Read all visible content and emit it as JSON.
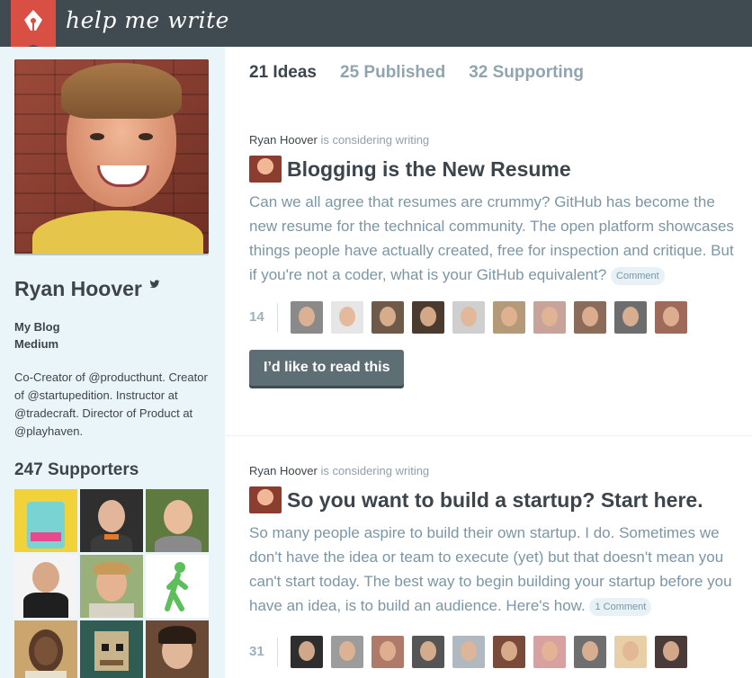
{
  "header": {
    "brand": "help me write"
  },
  "profile": {
    "name": "Ryan Hoover",
    "links": [
      "My Blog",
      "Medium"
    ],
    "bio": "Co-Creator of @producthunt. Creator of @startupedition. Instructor at @tradecraft. Director of Product at @playhaven.",
    "supporters_title": "247 Supporters"
  },
  "tabs": [
    {
      "label": "21 Ideas"
    },
    {
      "label": "25 Published"
    },
    {
      "label": "32 Supporting"
    }
  ],
  "posts": [
    {
      "author": "Ryan Hoover",
      "byline_suffix": "is considering writing",
      "title": "Blogging is the New Resume",
      "body": "Can we all agree that resumes are crummy? GitHub has become the new resume for the technical community. The open platform showcases things people have actually created, free for inspection and critique. But if you're not a coder, what is your GitHub equivalent?",
      "comment_label": "Comment",
      "supporter_count": "14",
      "button_label": "I’d like to read this"
    },
    {
      "author": "Ryan Hoover",
      "byline_suffix": "is considering writing",
      "title": "So you want to build a startup? Start here.",
      "body": "So many people aspire to build their own startup. I do. Sometimes we don't have the idea or team to execute (yet) but that doesn't mean you can't start today. The best way to begin building your startup before you have an idea, is to build an audience. Here's how.",
      "comment_label": "1 Comment",
      "supporter_count": "31"
    }
  ],
  "supporter_tile_colors": [
    "#f2d23a",
    "#3a3a3a",
    "#5f7a3f",
    "#f4f4f4",
    "#9ab07a",
    "#ffffff",
    "#caa66e",
    "#2f5d54",
    "#6b4a35"
  ],
  "post1_avatar_colors": [
    "#8a8a8a",
    "#e6e6e6",
    "#6f5a4a",
    "#4b3b2e",
    "#cfcfcf",
    "#b59a7a",
    "#c7a39a",
    "#8b6b5a",
    "#6d6d6d",
    "#a06a5a"
  ],
  "post2_avatar_colors": [
    "#2e2e2e",
    "#9c9c9c",
    "#b07a6a",
    "#555555",
    "#b0b8c0",
    "#7a4a3a",
    "#d9a0a0",
    "#6f6f6f",
    "#e8cfa8",
    "#4a3a3a"
  ]
}
